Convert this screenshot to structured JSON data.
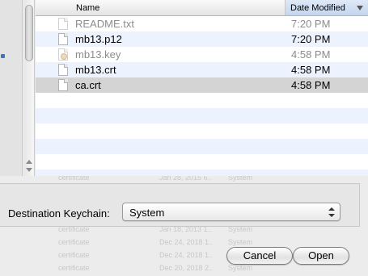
{
  "file_list": {
    "columns": {
      "name": "Name",
      "date_modified": "Date Modified"
    },
    "rows": [
      {
        "name": "README.txt",
        "date": "7:20 PM",
        "icon": "text-file-icon",
        "state": "dim"
      },
      {
        "name": "mb13.p12",
        "date": "7:20 PM",
        "icon": "file-icon",
        "state": "normal"
      },
      {
        "name": "mb13.key",
        "date": "4:58 PM",
        "icon": "key-file-icon",
        "state": "dim"
      },
      {
        "name": "mb13.crt",
        "date": "4:58 PM",
        "icon": "certificate-file-icon",
        "state": "normal"
      },
      {
        "name": "ca.crt",
        "date": "4:58 PM",
        "icon": "certificate-file-icon",
        "state": "selected"
      }
    ]
  },
  "destination": {
    "label": "Destination Keychain:",
    "selected": "System"
  },
  "buttons": {
    "cancel": "Cancel",
    "open": "Open"
  },
  "colors": {
    "window_bg": "#ececec",
    "row_alt": "#edf3fe",
    "row_selected": "#d4d4d4",
    "header_sorted": "#c3d5ee"
  }
}
